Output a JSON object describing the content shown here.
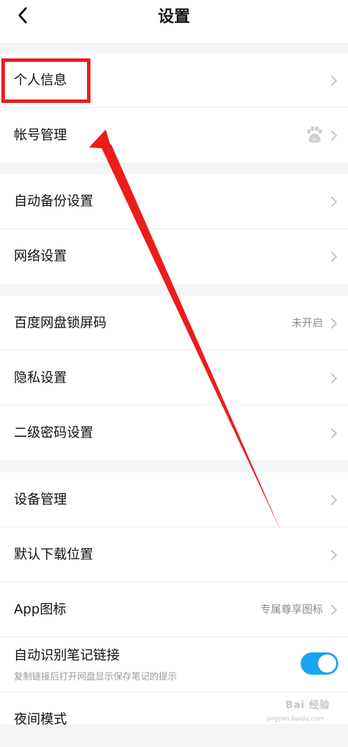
{
  "header": {
    "title": "设置",
    "back_icon": "chevron-left-icon"
  },
  "groups": [
    {
      "items": [
        {
          "label": "个人信息"
        },
        {
          "label": "帐号管理",
          "icon": "baidu-paw-icon",
          "icon_text": "du"
        }
      ]
    },
    {
      "items": [
        {
          "label": "自动备份设置"
        },
        {
          "label": "网络设置"
        }
      ]
    },
    {
      "items": [
        {
          "label": "百度网盘锁屏码",
          "value": "未开启"
        },
        {
          "label": "隐私设置"
        },
        {
          "label": "二级密码设置"
        }
      ]
    },
    {
      "items": [
        {
          "label": "设备管理"
        },
        {
          "label": "默认下载位置"
        },
        {
          "label": "App图标",
          "value": "专属尊享图标"
        },
        {
          "label": "自动识别笔记链接",
          "subtitle": "复制链接后打开网盘显示保存笔记的提示",
          "toggle_on": true
        },
        {
          "label": "夜间模式"
        }
      ]
    }
  ],
  "annotation": {
    "color": "#ec1c1c",
    "target": "个人信息"
  },
  "colors": {
    "accent": "#1aa3f6",
    "background": "#f3f4f6"
  },
  "watermark": {
    "text": "Bai 经验",
    "sub": "jingyan.baidu.com"
  }
}
